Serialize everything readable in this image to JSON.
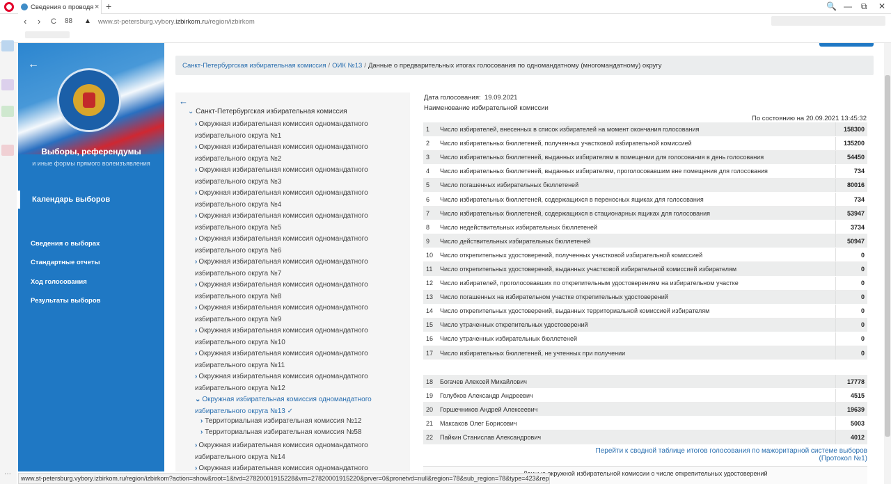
{
  "browser": {
    "tab_title": "Сведения о проводящихс",
    "tab_close": "×",
    "new_tab": "+",
    "url_prefix": "www.st-petersburg.vybory.",
    "url_domain": "izbirkom.ru",
    "url_path": "/region/izbirkom",
    "status_url": "www.st-petersburg.vybory.izbirkom.ru/region/izbirkom?action=show&root=1&tvd=27820001915228&vrn=27820001915220&prver=0&pronetvd=null&region=78&sub_region=78&type=423&report_mode=null",
    "nav_back": "‹",
    "nav_forward": "›",
    "reload": "C",
    "grid": "88",
    "warn": "▲",
    "search_icon": "🔍",
    "win_min": "—",
    "win_restore": "⧉",
    "win_close": "✕",
    "menu_dots": "···"
  },
  "sitenav": {
    "back": "←",
    "title": "Выборы, референдумы",
    "subtitle": "и иные формы прямого волеизъявления",
    "calendar": "Календарь выборов",
    "links": [
      "Сведения о выборах",
      "Стандартные отчеты",
      "Ход голосования",
      "Результаты выборов"
    ]
  },
  "breadcrumb": {
    "items": [
      "Санкт-Петербургская избирательная комиссия",
      "ОИК №13"
    ],
    "separator": "/",
    "current": "Данные о предварительных итогах голосования по одномандатному (многомандатному) округу"
  },
  "tree": {
    "back": "←",
    "root_chev": "⌄",
    "root": "Санкт-Петербургская избирательная комиссия",
    "item_chev": "›",
    "open_chev": "⌄",
    "item_prefix": "Окружная избирательная комиссия одномандатного",
    "districts": [
      "избирательного округа №1",
      "избирательного округа №2",
      "избирательного округа №3",
      "избирательного округа №4",
      "избирательного округа №5",
      "избирательного округа №6",
      "избирательного округа №7",
      "избирательного округа №8",
      "избирательного округа №9",
      "избирательного округа №10",
      "избирательного округа №11",
      "избирательного округа №12"
    ],
    "active_district": "избирательного округа №13",
    "check": "✓",
    "subitems": [
      "Территориальная избирательная комиссия №12",
      "Территориальная избирательная комиссия №58"
    ],
    "after_districts": [
      "избирательного округа №14"
    ],
    "last_prefix": "Окружная избирательная комиссия одномандатного"
  },
  "meta": {
    "date_label": "Дата голосования:",
    "date_value": "19.09.2021",
    "commission_label": "Наименование избирательной комиссии",
    "as_of": "По состоянию на 20.09.2021 13:45:32"
  },
  "results": [
    {
      "n": "1",
      "label": "Число избирателей, внесенных в список избирателей на момент окончания голосования",
      "value": "158300"
    },
    {
      "n": "2",
      "label": "Число избирательных бюллетеней, полученных участковой избирательной комиссией",
      "value": "135200"
    },
    {
      "n": "3",
      "label": "Число избирательных бюллетеней, выданных избирателям в помещении для голосования в день голосования",
      "value": "54450"
    },
    {
      "n": "4",
      "label": "Число избирательных бюллетеней, выданных избирателям, проголосовавшим вне помещения для голосования",
      "value": "734"
    },
    {
      "n": "5",
      "label": "Число погашенных избирательных бюллетеней",
      "value": "80016"
    },
    {
      "n": "6",
      "label": "Число избирательных бюллетеней, содержащихся в переносных ящиках для голосования",
      "value": "734"
    },
    {
      "n": "7",
      "label": "Число избирательных бюллетеней, содержащихся в стационарных ящиках для голосования",
      "value": "53947"
    },
    {
      "n": "8",
      "label": "Число недействительных избирательных бюллетеней",
      "value": "3734"
    },
    {
      "n": "9",
      "label": "Число действительных избирательных бюллетеней",
      "value": "50947"
    },
    {
      "n": "10",
      "label": "Число открепительных удостоверений, полученных участковой избирательной комиссией",
      "value": "0"
    },
    {
      "n": "11",
      "label": "Число открепительных удостоверений, выданных участковой избирательной комиссией избирателям",
      "value": "0"
    },
    {
      "n": "12",
      "label": "Число избирателей, проголосовавших по открепительным удостоверениям на избирательном участке",
      "value": "0"
    },
    {
      "n": "13",
      "label": "Число погашенных на избирательном участке открепительных удостоверений",
      "value": "0"
    },
    {
      "n": "14",
      "label": "Число открепительных удостоверений, выданных территориальной комиссией избирателям",
      "value": "0"
    },
    {
      "n": "15",
      "label": "Число утраченных открепительных удостоверений",
      "value": "0"
    },
    {
      "n": "16",
      "label": "Число утраченных избирательных бюллетеней",
      "value": "0"
    },
    {
      "n": "17",
      "label": "Число избирательных бюллетеней, не учтенных при получении",
      "value": "0"
    }
  ],
  "candidates": [
    {
      "n": "18",
      "label": "Богачев Алексей Михайлович",
      "value": "17778"
    },
    {
      "n": "19",
      "label": "Голубков Александр Андреевич",
      "value": "4515"
    },
    {
      "n": "20",
      "label": "Горшечников Андрей Алексеевич",
      "value": "19639"
    },
    {
      "n": "21",
      "label": "Максаков Олег Борисович",
      "value": "5003"
    },
    {
      "n": "22",
      "label": "Пайкин Станислав Александрович",
      "value": "4012"
    }
  ],
  "protocol_link": "Перейти к сводной таблице итогов голосования по мажоритарной системе выборов (Протокол №1)",
  "bottom_text": "Данные окружной избирательной комиссии о числе открепительных удостоверений"
}
